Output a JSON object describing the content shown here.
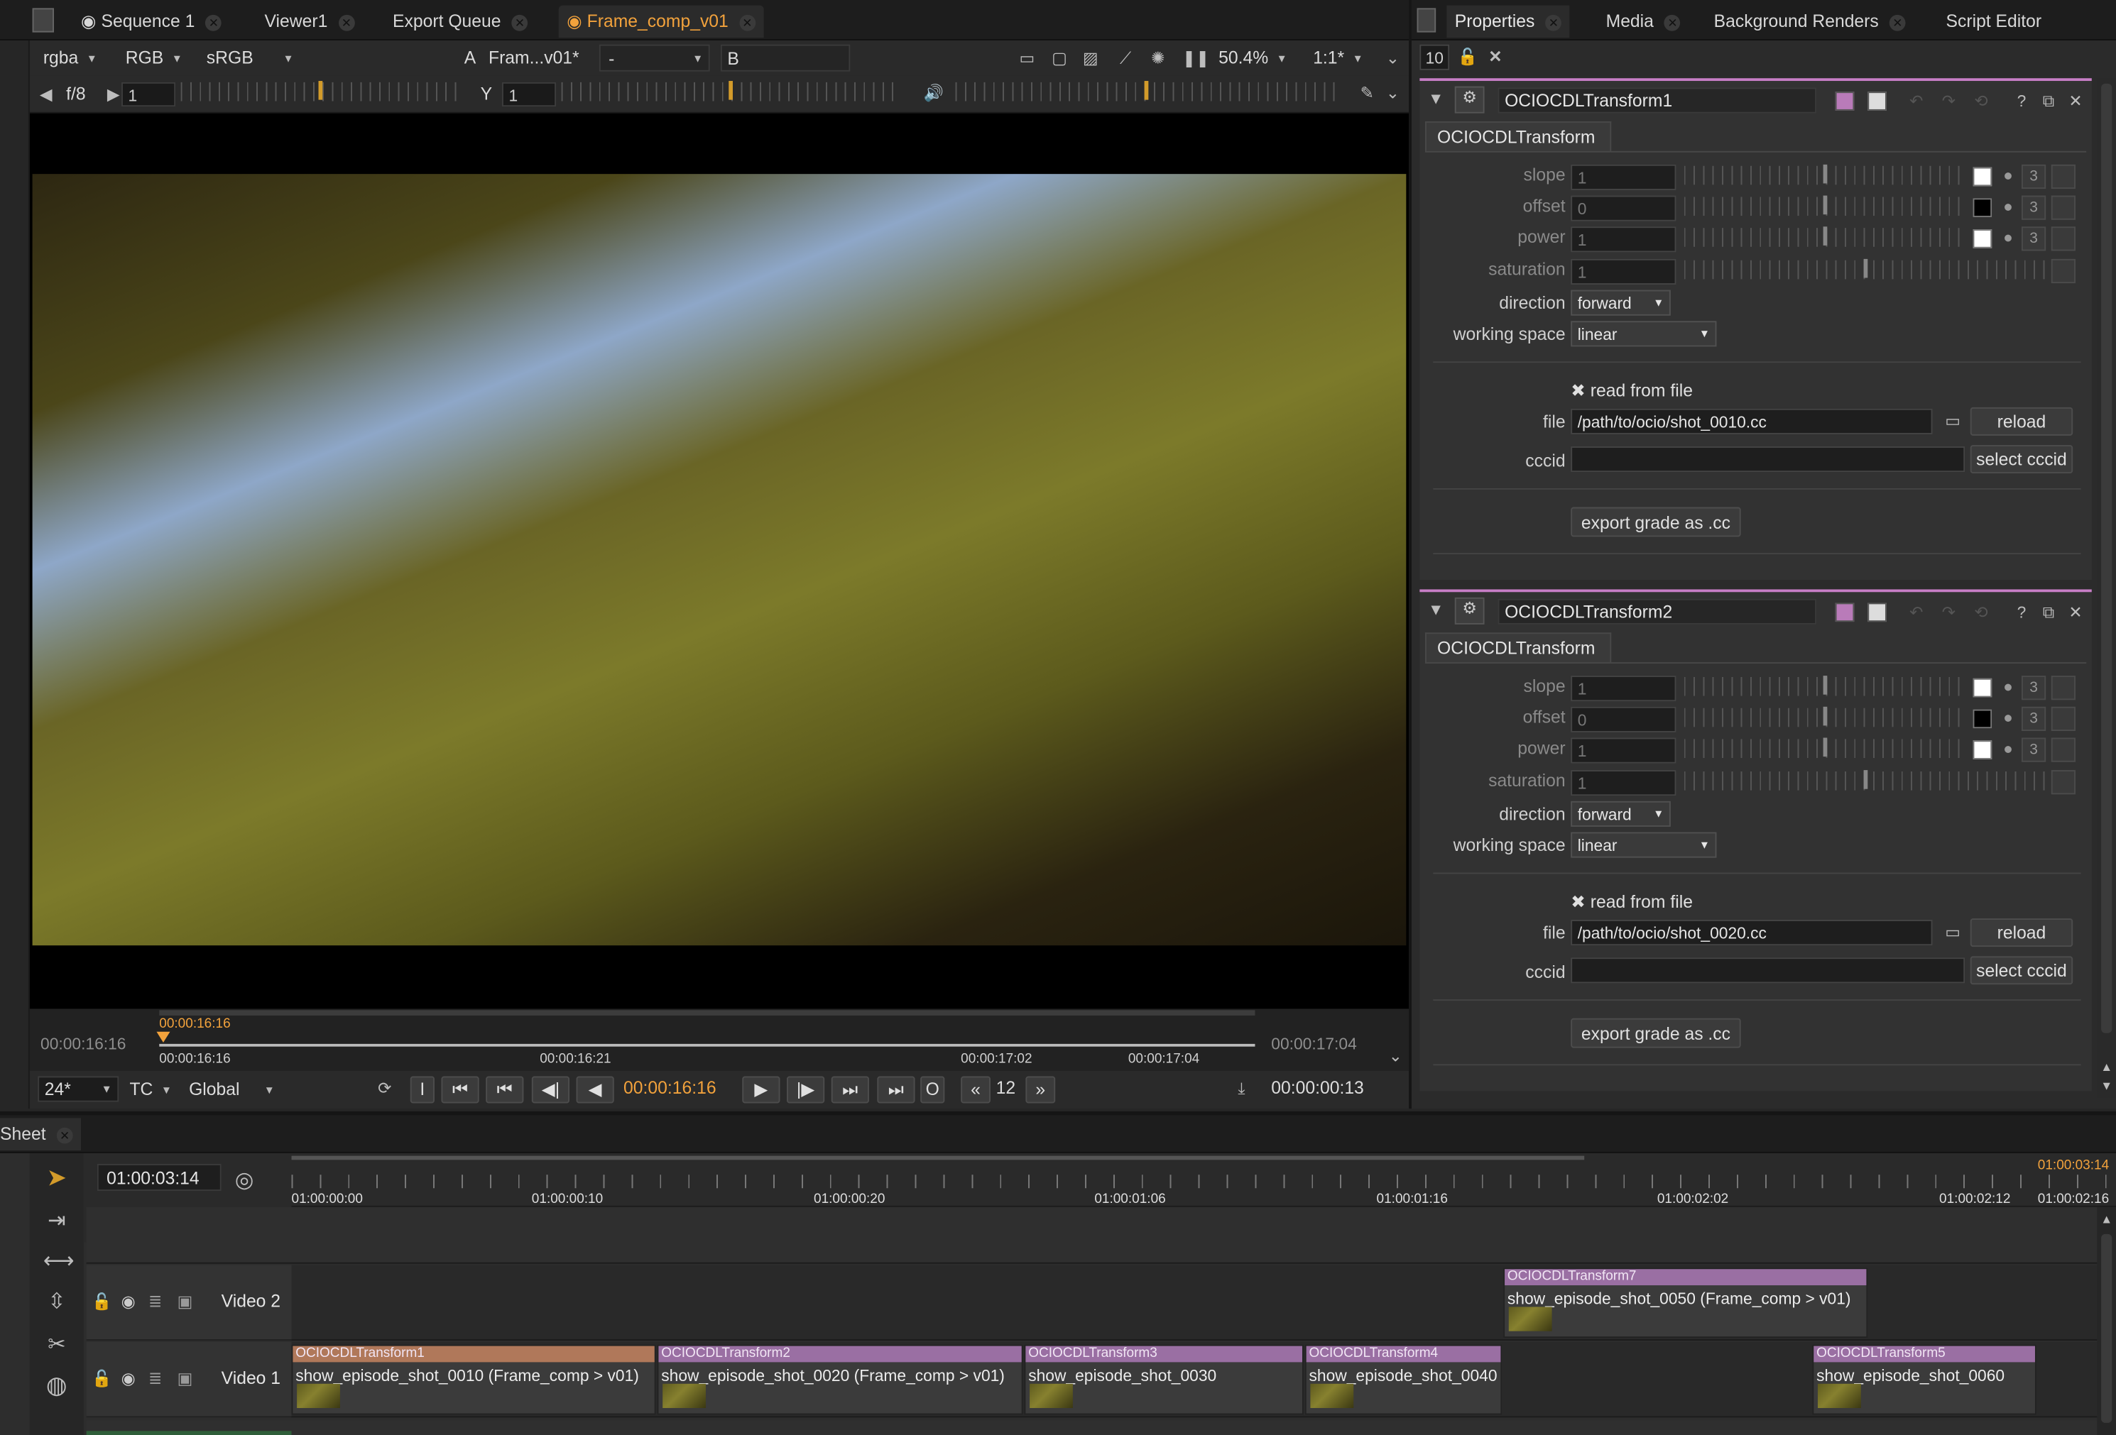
{
  "viewer_tabs": [
    {
      "label": "Sequence 1",
      "active": false
    },
    {
      "label": "Viewer1",
      "active": false
    },
    {
      "label": "Export Queue",
      "active": false
    },
    {
      "label": "Frame_comp_v01",
      "active": true
    }
  ],
  "panel_tabs": [
    "Properties",
    "Media",
    "Background Renders",
    "Script Editor"
  ],
  "viewer_toolbar": {
    "channels": "rgba",
    "rgb": "RGB",
    "colorspace": "sRGB",
    "a_label": "A",
    "a_input": "Fram...v01*",
    "op": "-",
    "b_label": "B",
    "zoom": "50.4%",
    "ratio": "1:1*"
  },
  "viewer_gain": {
    "fstop": "f/8",
    "gain_value": "1",
    "gamma_label": "Y",
    "gamma_value": "1"
  },
  "viewer_gain_ticks": [
    "0.015625",
    "0.1",
    "1",
    "16",
    "64"
  ],
  "viewer_gamma_ticks": [
    "0",
    "0.1",
    "0.5",
    "1",
    "2",
    "4"
  ],
  "scrub": {
    "current_marker": "00:00:16:16",
    "start": "00:00:16:16",
    "end": "00:00:17:04",
    "ticks": [
      "00:00:16:16",
      "00:00:16:21",
      "00:00:17:02",
      "00:00:17:04"
    ]
  },
  "playback": {
    "fps": "24*",
    "tc": "TC",
    "scope": "Global",
    "in_label": "I",
    "out_label": "O",
    "timecode": "00:00:16:16",
    "step": "12",
    "duration": "00:00:00:13"
  },
  "properties_header": {
    "count": "10",
    "lock_icon": "lock-icon",
    "clear_icon": "clear-panels-icon"
  },
  "transforms": [
    {
      "node": "OCIOCDLTransform1",
      "tab": "OCIOCDLTransform",
      "params": [
        {
          "label": "slope",
          "value": "1",
          "swatch": "#ffffff",
          "three": "3"
        },
        {
          "label": "offset",
          "value": "0",
          "swatch": "#000000",
          "three": "3"
        },
        {
          "label": "power",
          "value": "1",
          "swatch": "#ffffff",
          "three": "3"
        },
        {
          "label": "saturation",
          "value": "1"
        }
      ],
      "direction_label": "direction",
      "direction": "forward",
      "working_space_label": "working space",
      "working_space": "linear",
      "read_from_file_label": "read from file",
      "read_from_file": true,
      "file_label": "file",
      "file": "/path/to/ocio/shot_0010.cc",
      "reload": "reload",
      "cccid_label": "cccid",
      "cccid": "",
      "select_cccid": "select cccid",
      "export": "export grade as .cc"
    },
    {
      "node": "OCIOCDLTransform2",
      "tab": "OCIOCDLTransform",
      "params": [
        {
          "label": "slope",
          "value": "1",
          "swatch": "#ffffff",
          "three": "3"
        },
        {
          "label": "offset",
          "value": "0",
          "swatch": "#000000",
          "three": "3"
        },
        {
          "label": "power",
          "value": "1",
          "swatch": "#ffffff",
          "three": "3"
        },
        {
          "label": "saturation",
          "value": "1"
        }
      ],
      "direction_label": "direction",
      "direction": "forward",
      "working_space_label": "working space",
      "working_space": "linear",
      "read_from_file_label": "read from file",
      "read_from_file": true,
      "file_label": "file",
      "file": "/path/to/ocio/shot_0020.cc",
      "reload": "reload",
      "cccid_label": "cccid",
      "cccid": "",
      "select_cccid": "select cccid",
      "export": "export grade as .cc"
    }
  ],
  "slope_ticks": [
    "0",
    "0.1",
    "0.5",
    "1",
    "2",
    "3",
    "4"
  ],
  "offset_ticks": [
    "-0.2",
    "-0.1",
    "0",
    "0.1",
    "0.2"
  ],
  "sat_ticks": [
    "0",
    "0.1",
    "0.5",
    "1",
    "2",
    "3",
    "4"
  ],
  "timeline": {
    "tab": "Sheet",
    "timecode": "01:00:03:14",
    "right_marker": "01:00:03:14",
    "ruler": [
      "01:00:00:00",
      "01:00:00:10",
      "01:00:00:20",
      "01:00:01:06",
      "01:00:01:16",
      "01:00:02:02",
      "01:00:02:12",
      "01:00:02:16"
    ],
    "tracks": [
      {
        "name": "Video 2",
        "clips": [
          {
            "effect": "OCIOCDLTransform7",
            "name": "show_episode_shot_0050 (Frame_comp > v01)"
          }
        ]
      },
      {
        "name": "Video 1",
        "clips": [
          {
            "effect": "OCIOCDLTransform1",
            "name": "show_episode_shot_0010 (Frame_comp > v01)",
            "selected": true
          },
          {
            "effect": "OCIOCDLTransform2",
            "name": "show_episode_shot_0020 (Frame_comp > v01)"
          },
          {
            "effect": "OCIOCDLTransform3",
            "name": "show_episode_shot_0030"
          },
          {
            "effect": "OCIOCDLTransform4",
            "name": "show_episode_shot_0040"
          },
          {
            "effect": "OCIOCDLTransform5",
            "name": "show_episode_shot_0060"
          }
        ]
      }
    ]
  }
}
